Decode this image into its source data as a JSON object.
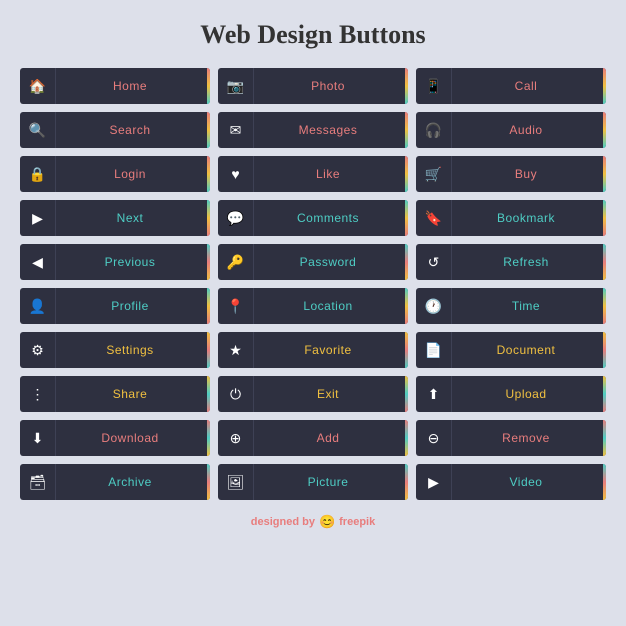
{
  "title": "Web Design Buttons",
  "buttons": [
    {
      "label": "Home",
      "icon": "🏠",
      "row": 0
    },
    {
      "label": "Photo",
      "icon": "📷",
      "row": 0
    },
    {
      "label": "Call",
      "icon": "📱",
      "row": 0
    },
    {
      "label": "Search",
      "icon": "🔍",
      "row": 1
    },
    {
      "label": "Messages",
      "icon": "✉",
      "row": 1
    },
    {
      "label": "Audio",
      "icon": "🎧",
      "row": 1
    },
    {
      "label": "Login",
      "icon": "🔒",
      "row": 2
    },
    {
      "label": "Like",
      "icon": "♥",
      "row": 2
    },
    {
      "label": "Buy",
      "icon": "🛒",
      "row": 2
    },
    {
      "label": "Next",
      "icon": "▶",
      "row": 3
    },
    {
      "label": "Comments",
      "icon": "💬",
      "row": 3
    },
    {
      "label": "Bookmark",
      "icon": "🔖",
      "row": 3
    },
    {
      "label": "Previous",
      "icon": "◀",
      "row": 4
    },
    {
      "label": "Password",
      "icon": "🔑",
      "row": 4
    },
    {
      "label": "Refresh",
      "icon": "↺",
      "row": 4
    },
    {
      "label": "Profile",
      "icon": "👤",
      "row": 5
    },
    {
      "label": "Location",
      "icon": "📍",
      "row": 5
    },
    {
      "label": "Time",
      "icon": "🕐",
      "row": 5
    },
    {
      "label": "Settings",
      "icon": "⚙",
      "row": 6
    },
    {
      "label": "Favorite",
      "icon": "★",
      "row": 6
    },
    {
      "label": "Document",
      "icon": "📄",
      "row": 6
    },
    {
      "label": "Share",
      "icon": "⋮",
      "row": 7
    },
    {
      "label": "Exit",
      "icon": "⏻",
      "row": 7
    },
    {
      "label": "Upload",
      "icon": "⬆",
      "row": 7
    },
    {
      "label": "Download",
      "icon": "⬇",
      "row": 8
    },
    {
      "label": "Add",
      "icon": "⊕",
      "row": 8
    },
    {
      "label": "Remove",
      "icon": "⊖",
      "row": 8
    },
    {
      "label": "Archive",
      "icon": "🗃",
      "row": 9
    },
    {
      "label": "Picture",
      "icon": "🖼",
      "row": 9
    },
    {
      "label": "Video",
      "icon": "▶",
      "row": 9
    }
  ],
  "rowColors": [
    "#e87d7d",
    "#e87d7d",
    "#e87d7d",
    "#4ecdc4",
    "#4ecdc4",
    "#4ecdc4",
    "#f0c040",
    "#f0c040",
    "#e87d7d",
    "#4ecdc4"
  ],
  "footer": {
    "designed_by": "designed by",
    "brand": "freepik"
  }
}
